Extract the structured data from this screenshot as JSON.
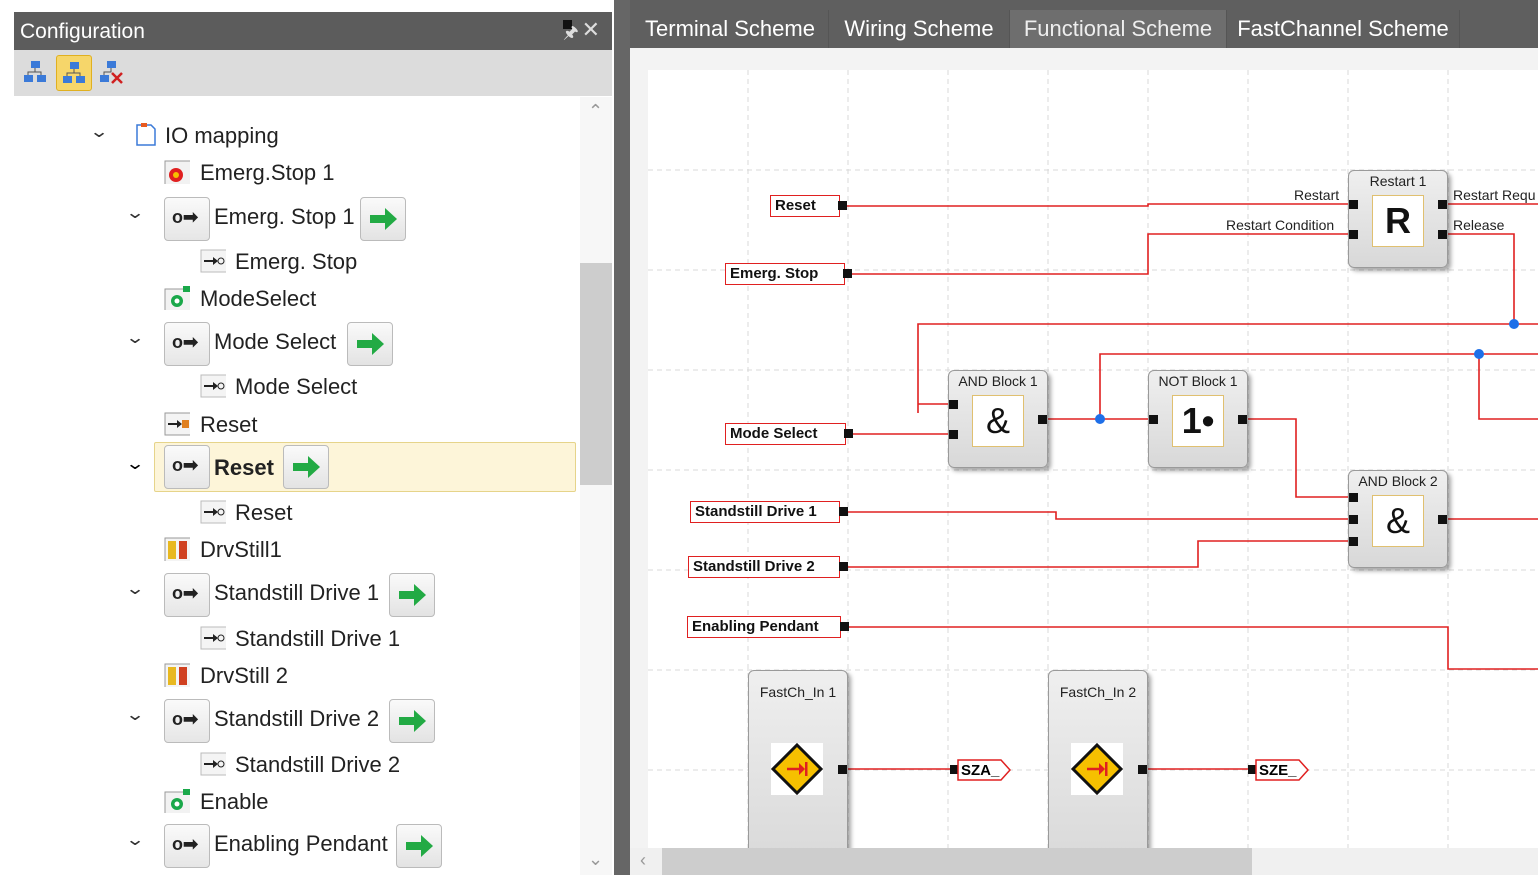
{
  "left_panel": {
    "title": "Configuration",
    "pin_glyph": "ᵽ",
    "close_glyph": "✕",
    "toolbar": [
      "connect-icon",
      "network-icon",
      "disconnect-icon"
    ],
    "tree": [
      {
        "label": "IO mapping",
        "expanded": true,
        "icon": "mapping-icon"
      },
      {
        "label": "Emerg.Stop 1",
        "icon": "emergency-stop-icon"
      },
      {
        "label": "Emerg. Stop 1",
        "expanded": true,
        "icon": "input-block-icon",
        "arrow_marker": true
      },
      {
        "label": "Emerg. Stop",
        "icon": "signal-icon"
      },
      {
        "label": "ModeSelect",
        "icon": "camera-switch-icon"
      },
      {
        "label": "Mode Select",
        "expanded": true,
        "icon": "input-block-icon"
      },
      {
        "label": "Mode Select",
        "icon": "signal-icon"
      },
      {
        "label": "Reset",
        "icon": "reset-input-icon"
      },
      {
        "label": "Reset",
        "expanded": true,
        "icon": "input-block-icon",
        "selected": true
      },
      {
        "label": "Reset",
        "icon": "signal-icon"
      },
      {
        "label": "DrvStill1",
        "icon": "drive-standstill-icon"
      },
      {
        "label": "Standstill Drive 1",
        "expanded": true,
        "icon": "input-block-icon"
      },
      {
        "label": "Standstill Drive 1",
        "icon": "signal-icon"
      },
      {
        "label": "DrvStill 2",
        "icon": "drive-standstill-icon"
      },
      {
        "label": "Standstill Drive 2",
        "expanded": true,
        "icon": "input-block-icon"
      },
      {
        "label": "Standstill Drive 2",
        "icon": "signal-icon"
      },
      {
        "label": "Enable",
        "icon": "camera-switch-icon"
      },
      {
        "label": "Enabling Pendant",
        "expanded": true,
        "icon": "input-block-icon"
      }
    ],
    "input_block_glyph": "o➡",
    "signal_glyph": "➞o"
  },
  "tabs": [
    {
      "label": "Terminal Scheme",
      "active": false
    },
    {
      "label": "Wiring Scheme",
      "active": false
    },
    {
      "label": "Functional Scheme",
      "active": true
    },
    {
      "label": "FastChannel Scheme",
      "active": false
    }
  ],
  "diagram": {
    "inputs": [
      "Reset",
      "Emerg. Stop",
      "Mode Select",
      "Standstill Drive 1",
      "Standstill Drive 2",
      "Enabling Pendant"
    ],
    "blocks": {
      "restart": {
        "title": "Restart 1",
        "symbol": "R",
        "in1": "Restart",
        "in2": "Restart Condition",
        "out1": "Restart Requ",
        "out2": "Release"
      },
      "and1": {
        "title": "AND Block 1",
        "symbol": "&"
      },
      "not1": {
        "title": "NOT Block 1",
        "symbol": "1•"
      },
      "and2": {
        "title": "AND Block 2",
        "symbol": "&"
      },
      "fast1": {
        "title": "FastCh_In 1"
      },
      "fast2": {
        "title": "FastCh_In 2"
      }
    },
    "outputs": [
      "SZA_",
      "SZE_"
    ]
  },
  "colors": {
    "wire": "#e02020",
    "junction": "#1e6fe8",
    "marker_arrow": "#1aa84a"
  }
}
